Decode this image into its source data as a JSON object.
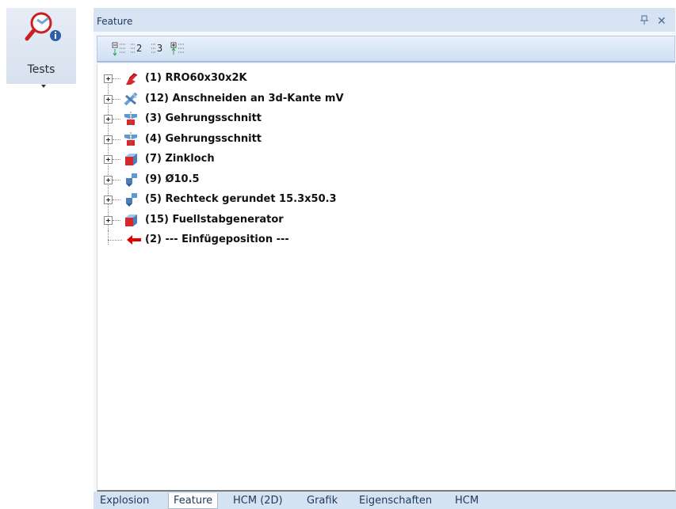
{
  "ribbon": {
    "tests_label": "Tests"
  },
  "panel": {
    "title": "Feature",
    "pin_glyph": "\u0004",
    "close_glyph": "✕",
    "toolbar": {
      "level2_label": "2",
      "level3_label": "3"
    },
    "tree": {
      "items": [
        {
          "label": "(1) RRO60x30x2K",
          "icon": "profile-icon",
          "expandable": true
        },
        {
          "label": "(12) Anschneiden an 3d-Kante mV",
          "icon": "cut-edge-icon",
          "expandable": true
        },
        {
          "label": "(3) Gehrungsschnitt",
          "icon": "miter-cut-icon",
          "expandable": true
        },
        {
          "label": "(4) Gehrungsschnitt",
          "icon": "miter-cut-icon",
          "expandable": true
        },
        {
          "label": "(7) Zinkloch",
          "icon": "hole-block-icon",
          "expandable": true
        },
        {
          "label": "(9)  Ø10.5",
          "icon": "drill-icon",
          "expandable": true
        },
        {
          "label": "(5)  Rechteck gerundet 15.3x50.3",
          "icon": "drill-icon",
          "expandable": true
        },
        {
          "label": "(15) Fuellstabgenerator",
          "icon": "hole-block-icon",
          "expandable": true
        },
        {
          "label": "(2) --- Einfügeposition ---",
          "icon": "insert-arrow-icon",
          "expandable": false
        }
      ]
    }
  },
  "tabs": [
    {
      "label": "Explosion",
      "active": false
    },
    {
      "label": "Feature",
      "active": true
    },
    {
      "label": "HCM (2D)",
      "active": false
    },
    {
      "label": "Grafik",
      "active": false
    },
    {
      "label": "Eigenschaften",
      "active": false
    },
    {
      "label": "HCM",
      "active": false
    }
  ],
  "colors": {
    "panel_title_bg": "#d7e3f3",
    "tab_strip_bg": "#d5e2f2",
    "insert_arrow": "#e00000"
  }
}
